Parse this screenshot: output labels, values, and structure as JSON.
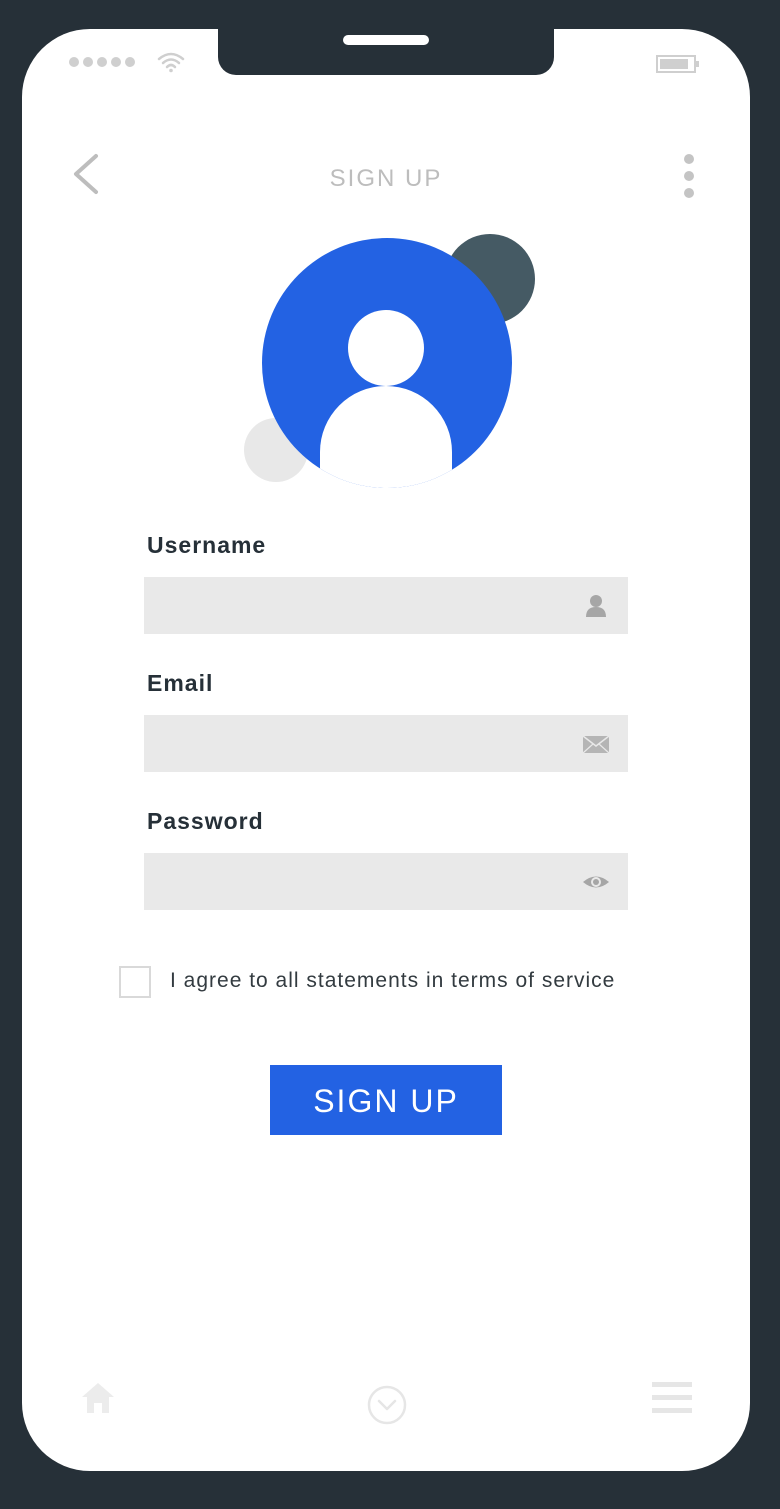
{
  "status_bar": {
    "signal_dots": 5,
    "wifi_icon": "wifi-icon",
    "battery_icon": "battery-icon"
  },
  "header": {
    "title": "SIGN UP",
    "back_icon": "chevron-left-icon",
    "more_icon": "more-vertical-icon"
  },
  "avatar": {
    "icon": "user-icon",
    "color": "#2362e3"
  },
  "form": {
    "username": {
      "label": "Username",
      "value": "",
      "icon": "user-icon"
    },
    "email": {
      "label": "Email",
      "value": "",
      "icon": "mail-icon"
    },
    "password": {
      "label": "Password",
      "value": "",
      "icon": "eye-icon"
    },
    "terms": {
      "label": "I agree to all statements in terms of service",
      "checked": false
    },
    "submit_label": "SIGN UP"
  },
  "bottom_nav": {
    "items": [
      {
        "icon": "home-icon"
      },
      {
        "icon": "chevron-down-circle-icon"
      },
      {
        "icon": "menu-icon"
      }
    ]
  },
  "colors": {
    "accent": "#2362e3",
    "frame": "#263038",
    "field_background": "#e9e9e9",
    "decor_dark": "#455a64"
  }
}
